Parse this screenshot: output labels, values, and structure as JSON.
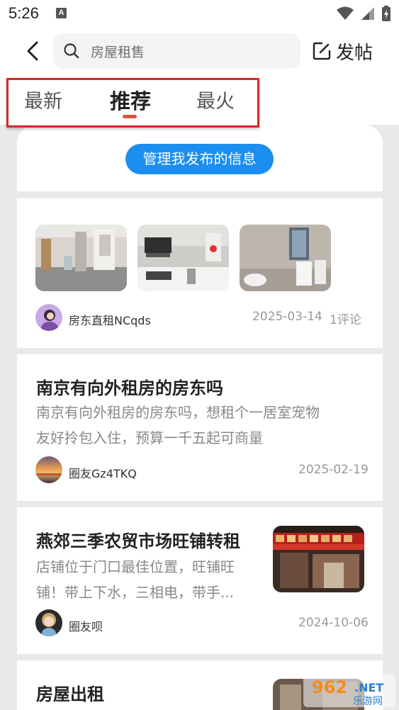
{
  "status_bar": {
    "time": "5:26",
    "notification_badge": "A"
  },
  "header": {
    "search_placeholder": "房屋租售",
    "post_label": "发帖"
  },
  "tabs": [
    {
      "label": "最新",
      "active": false
    },
    {
      "label": "推荐",
      "active": true
    },
    {
      "label": "最火",
      "active": false
    }
  ],
  "manage_button": "管理我发布的信息",
  "posts": [
    {
      "author": "房东直租NCqds",
      "date": "2025-03-14",
      "comments": "1评论"
    },
    {
      "title": "南京有向外租房的房东吗",
      "body_line1": "南京有向外租房的房东吗，想租个一居室宠物",
      "body_line2": "友好拎包入住，预算一千五起可商量",
      "author": "圈友Gz4TKQ",
      "date": "2025-02-19"
    },
    {
      "title": "燕郊三季农贸市场旺铺转租",
      "body_line1": "店铺位于门口最佳位置，旺铺旺",
      "body_line2": "铺！带上下水，三相电，带手...",
      "author": "圈友呗",
      "date": "2024-10-06"
    },
    {
      "title": "房屋出租"
    }
  ],
  "watermark": {
    "number": "962",
    "suffix": ".NET",
    "subtitle": "乐游网"
  },
  "colors": {
    "accent_blue": "#1c8ef0",
    "tab_indicator": "#e0533b",
    "highlight_red": "#d32a2a",
    "background": "#e9e9e9"
  }
}
